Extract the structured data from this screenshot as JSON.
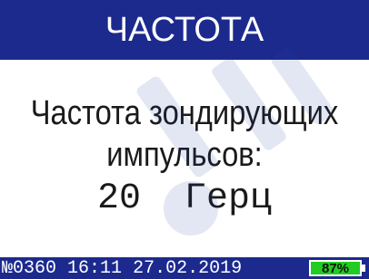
{
  "screen": {
    "title": "ЧАСТОТА",
    "label_line1": "Частота зондирующих",
    "label_line2": "импульсов:",
    "value": "20",
    "unit": "Герц"
  },
  "status": {
    "device_no": "№0360",
    "time": "16:11",
    "date": "27.02.2019",
    "battery_percent": "87%",
    "battery_level": 0.87
  },
  "colors": {
    "header_bg": "#1c2a8e",
    "battery_fill": "#22cc22",
    "watermark": "#1c3fa0"
  }
}
